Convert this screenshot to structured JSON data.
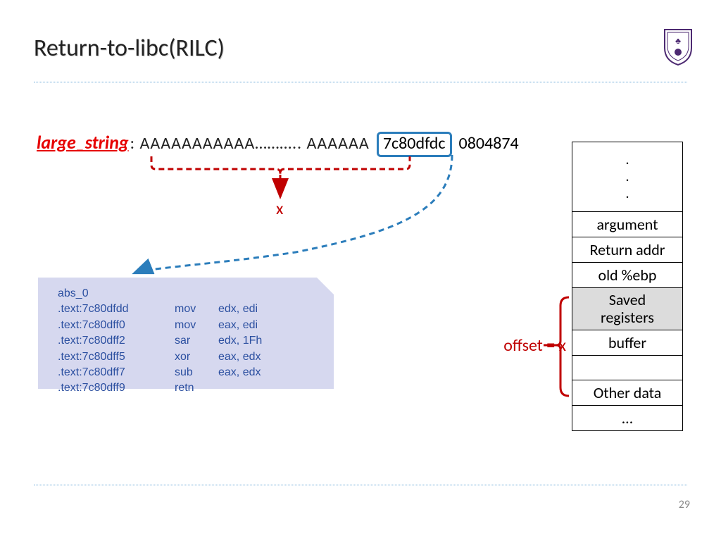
{
  "title": "Return-to-libc(RILC)",
  "page_number": "29",
  "large_string": {
    "label": "large_string",
    "aaaa": ": AAAAAAAAAAA……….. AAAAAA",
    "boxed_addr": "7c80dfdc",
    "trailing": "0804874"
  },
  "x_label": "x",
  "offset_label": "offset = x",
  "asm": {
    "header": "abs_0",
    "rows": [
      {
        "a": ".text:7c80dfdd",
        "b": "mov",
        "c": "edx, edi"
      },
      {
        "a": ".text:7c80dff0",
        "b": "mov",
        "c": "eax, edi"
      },
      {
        "a": ".text:7c80dff2",
        "b": "sar",
        "c": "edx, 1Fh"
      },
      {
        "a": ".text:7c80dff5",
        "b": "xor",
        "c": "eax, edx"
      },
      {
        "a": ".text:7c80dff7",
        "b": "sub",
        "c": "eax, edx"
      },
      {
        "a": ".text:7c80dff9",
        "b": "retn",
        "c": ""
      }
    ]
  },
  "stack": {
    "top_dots": ".\n.\n.",
    "cells": [
      "argument",
      "Return addr",
      "old %ebp",
      "Saved registers",
      "buffer",
      "",
      "Other data",
      "…"
    ]
  }
}
